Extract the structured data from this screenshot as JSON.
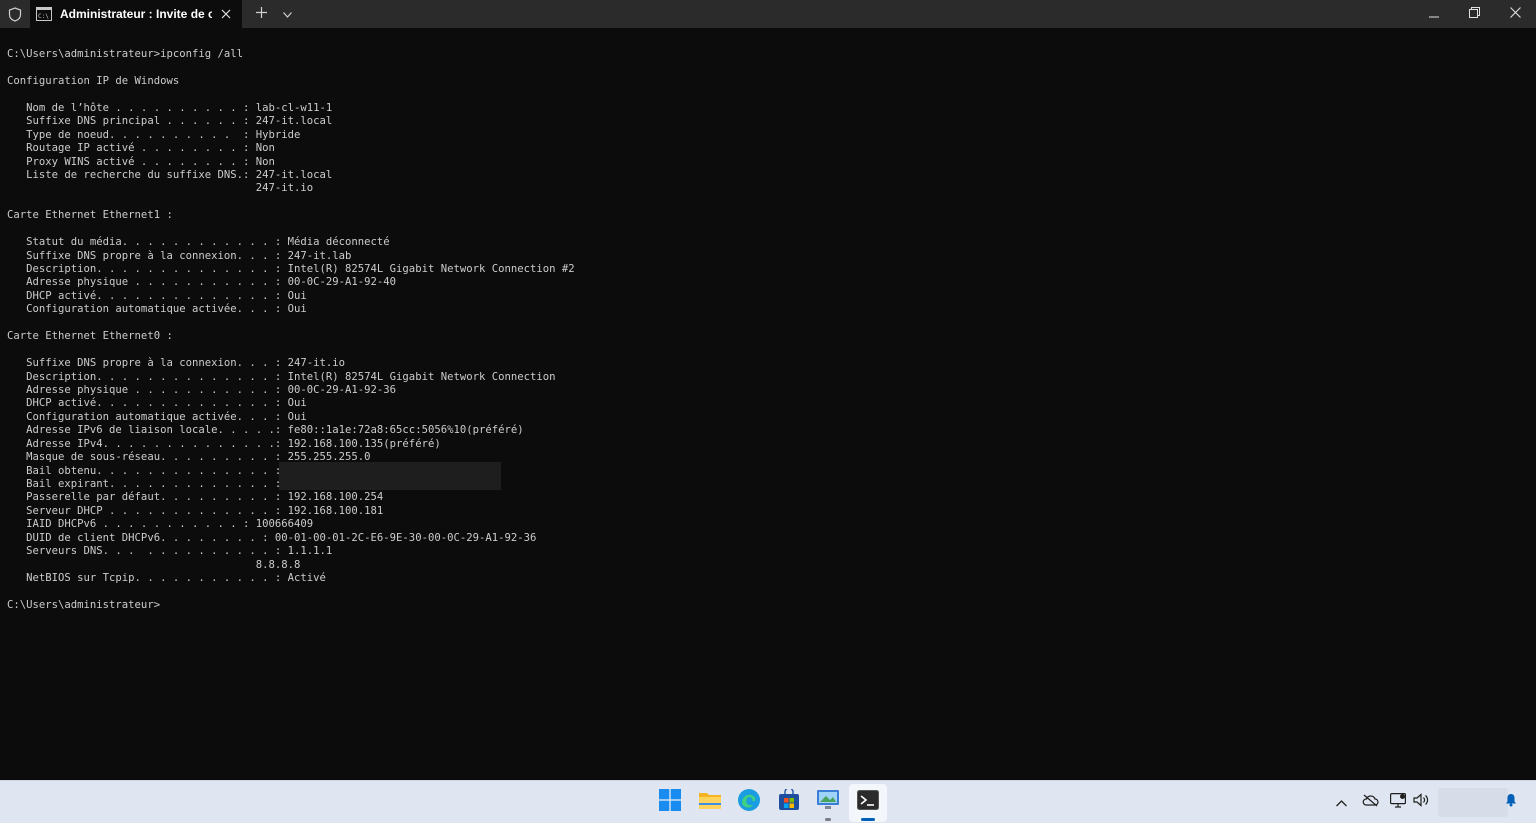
{
  "window": {
    "tab_title": "Administrateur : Invite de con",
    "icons": {
      "shield": "shield-icon",
      "tab": "cmd-icon",
      "close_tab": "close-icon",
      "new_tab": "plus-icon",
      "dropdown": "chevron-down-icon",
      "minimize": "minimize-icon",
      "maximize": "restore-icon",
      "close": "close-icon"
    }
  },
  "terminal": {
    "text": "C:\\Users\\administrateur>ipconfig /all\n\nConfiguration IP de Windows\n\n   Nom de l’hôte . . . . . . . . . . : lab-cl-w11-1\n   Suffixe DNS principal . . . . . . : 247-it.local\n   Type de noeud. . . . . . . . . .  : Hybride\n   Routage IP activé . . . . . . . . : Non\n   Proxy WINS activé . . . . . . . . : Non\n   Liste de recherche du suffixe DNS.: 247-it.local\n                                       247-it.io\n\nCarte Ethernet Ethernet1 :\n\n   Statut du média. . . . . . . . . . . . : Média déconnecté\n   Suffixe DNS propre à la connexion. . . : 247-it.lab\n   Description. . . . . . . . . . . . . . : Intel(R) 82574L Gigabit Network Connection #2\n   Adresse physique . . . . . . . . . . . : 00-0C-29-A1-92-40\n   DHCP activé. . . . . . . . . . . . . . : Oui\n   Configuration automatique activée. . . : Oui\n\nCarte Ethernet Ethernet0 :\n\n   Suffixe DNS propre à la connexion. . . : 247-it.io\n   Description. . . . . . . . . . . . . . : Intel(R) 82574L Gigabit Network Connection\n   Adresse physique . . . . . . . . . . . : 00-0C-29-A1-92-36\n   DHCP activé. . . . . . . . . . . . . . : Oui\n   Configuration automatique activée. . . : Oui\n   Adresse IPv6 de liaison locale. . . . .: fe80::1a1e:72a8:65cc:5056%10(préféré)\n   Adresse IPv4. . . . . . . . . . . . . .: 192.168.100.135(préféré)\n   Masque de sous-réseau. . . . . . . . . : 255.255.255.0\n   Bail obtenu. . . . . . . . . . . . . . :\n   Bail expirant. . . . . . . . . . . . . :\n   Passerelle par défaut. . . . . . . . . : 192.168.100.254\n   Serveur DHCP . . . . . . . . . . . . . : 192.168.100.181\n   IAID DHCPv6 . . . . . . . . . . . : 100666409\n   DUID de client DHCPv6. . . . . . . . : 00-01-00-01-2C-E6-9E-30-00-0C-29-A1-92-36\n   Serveurs DNS. . .  . . . . . . . . . . : 1.1.1.1\n                                       8.8.8.8\n   NetBIOS sur Tcpip. . . . . . . . . . . : Activé\n\nC:\\Users\\administrateur>"
  },
  "taskbar": {
    "apps": [
      {
        "icon": "windows-start-icon",
        "active": false
      },
      {
        "icon": "file-explorer-icon",
        "active": false
      },
      {
        "icon": "edge-browser-icon",
        "active": false
      },
      {
        "icon": "microsoft-store-icon",
        "active": false
      },
      {
        "icon": "control-panel-icon",
        "active": false,
        "running": true
      },
      {
        "icon": "terminal-icon",
        "active": true,
        "running": true
      }
    ],
    "tray_icons": [
      "chevron-up-icon",
      "onedrive-icon",
      "network-icon",
      "volume-icon",
      "notification-bell-icon"
    ]
  },
  "colors": {
    "titlebar": "#2b2b2b",
    "terminal_bg": "#0c0c0c",
    "terminal_text": "#cccccc",
    "taskbar": "#dfe6f1",
    "accent": "#005fb8"
  }
}
